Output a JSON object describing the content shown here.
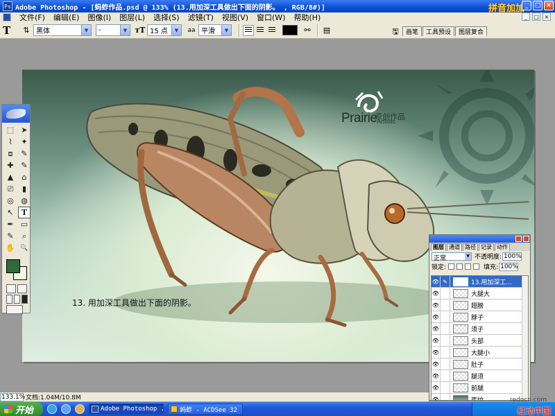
{
  "window": {
    "title": "Adobe Photoshop - [蚂蚱作品.psd @ 133% (13.用加深工具做出下面的阴影。  , RGB/8#)]",
    "brand_overlay": "拼音加加",
    "controls": [
      "_",
      "□",
      "×"
    ]
  },
  "menubar": {
    "items": [
      "文件(F)",
      "编辑(E)",
      "图像(I)",
      "图层(L)",
      "选择(S)",
      "滤镜(T)",
      "视图(V)",
      "窗口(W)",
      "帮助(H)"
    ]
  },
  "options": {
    "tool_glyph": "T",
    "font_family": "黑体",
    "font_style": "-",
    "font_size": "15 点",
    "antialias_label": "aa",
    "antialias": "平滑",
    "text_color": "#000000",
    "palette_well_tabs": [
      "画笔",
      "工具预设",
      "图层复合"
    ]
  },
  "canvas": {
    "caption": "13. 用加深工具做出下面的阴影。",
    "logo_text": "Prairie",
    "logo_sub": "原创作品",
    "logo_artistic": "Artistic"
  },
  "toolbox": {
    "tools": [
      "⬚",
      "➤",
      "⌇",
      "✦",
      "⧈",
      "✎",
      "✚",
      "✎",
      "▲",
      "⌂",
      "⎚",
      "▮",
      "◎",
      "◍",
      "↖",
      "T",
      "✒",
      "▭",
      "✎",
      "⌕",
      "✋",
      "🔍"
    ],
    "fg_color": "#2f6a3a",
    "bg_color": "#f1f5e6"
  },
  "layers_panel": {
    "tabs": [
      "图层",
      "通道",
      "路径",
      "记录",
      "动作"
    ],
    "blend_mode": "正常",
    "opacity_label": "不透明度:",
    "opacity": "100%",
    "lock_label": "锁定:",
    "fill_label": "填充:",
    "fill": "100%",
    "layers": [
      {
        "name": "13.用加深工...",
        "type": "text",
        "selected": true
      },
      {
        "name": "大腿大",
        "type": "pixel",
        "selected": false
      },
      {
        "name": "翅膀",
        "type": "pixel",
        "selected": false
      },
      {
        "name": "脖子",
        "type": "pixel",
        "selected": false
      },
      {
        "name": "须子",
        "type": "pixel",
        "selected": false
      },
      {
        "name": "头部",
        "type": "pixel",
        "selected": false
      },
      {
        "name": "大腿小",
        "type": "pixel",
        "selected": false
      },
      {
        "name": "肚子",
        "type": "pixel",
        "selected": false
      },
      {
        "name": "腿须",
        "type": "pixel",
        "selected": false
      },
      {
        "name": "前腿",
        "type": "pixel",
        "selected": false
      },
      {
        "name": "底纹",
        "type": "pixel",
        "selected": false
      }
    ]
  },
  "statusbar": {
    "zoom": "133.1%",
    "doc_info": "文档:1.04M/10.8M"
  },
  "taskbar": {
    "start_label": "开始",
    "tasks": [
      "Adobe Photoshop ...",
      "蚂蚱 - ACDSee 32 ..."
    ],
    "watermark": "红动中国",
    "watermark_url": "redocn.com"
  }
}
